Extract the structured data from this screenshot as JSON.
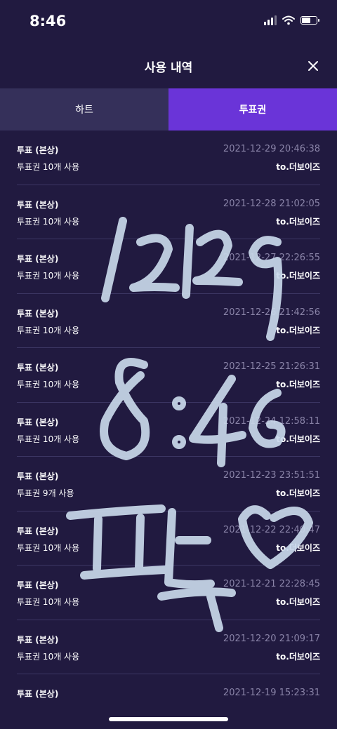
{
  "status_bar": {
    "time": "8:46"
  },
  "header": {
    "title": "사용 내역"
  },
  "tabs": [
    {
      "label": "하트",
      "active": false
    },
    {
      "label": "투표권",
      "active": true
    }
  ],
  "records": [
    {
      "title": "투표 (본상)",
      "date": "2021-12-29 20:46:38",
      "desc": "투표권 10개 사용",
      "target": "to.더보이즈"
    },
    {
      "title": "투표 (본상)",
      "date": "2021-12-28 21:02:05",
      "desc": "투표권 10개 사용",
      "target": "to.더보이즈"
    },
    {
      "title": "투표 (본상)",
      "date": "2021-12-27 22:26:55",
      "desc": "투표권 10개 사용",
      "target": "to.더보이즈"
    },
    {
      "title": "투표 (본상)",
      "date": "2021-12-26 21:42:56",
      "desc": "투표권 10개 사용",
      "target": "to.더보이즈"
    },
    {
      "title": "투표 (본상)",
      "date": "2021-12-25 21:26:31",
      "desc": "투표권 10개 사용",
      "target": "to.더보이즈"
    },
    {
      "title": "투표 (본상)",
      "date": "2021-12-24 12:58:11",
      "desc": "투표권 10개 사용",
      "target": "to.더보이즈"
    },
    {
      "title": "투표 (본상)",
      "date": "2021-12-23 23:51:51",
      "desc": "투표권 9개 사용",
      "target": "to.더보이즈"
    },
    {
      "title": "투표 (본상)",
      "date": "2021-12-22 22:40:47",
      "desc": "투표권 10개 사용",
      "target": "to.더보이즈"
    },
    {
      "title": "투표 (본상)",
      "date": "2021-12-21 22:28:45",
      "desc": "투표권 10개 사용",
      "target": "to.더보이즈"
    },
    {
      "title": "투표 (본상)",
      "date": "2021-12-20 21:09:17",
      "desc": "투표권 10개 사용",
      "target": "to.더보이즈"
    },
    {
      "title": "투표 (본상)",
      "date": "2021-12-19 15:23:31",
      "desc": "",
      "target": ""
    }
  ],
  "colors": {
    "background": "#211a40",
    "accent": "#6a34d8",
    "inactive_tab": "#35305a",
    "date_text": "#8a84a8"
  },
  "icons": {
    "close": "close-icon",
    "wifi": "wifi-icon",
    "signal": "signal-icon",
    "battery": "battery-icon"
  },
  "handwritten_note": {
    "lines": [
      "12월29",
      "8:46",
      "퍤톡♡"
    ]
  }
}
